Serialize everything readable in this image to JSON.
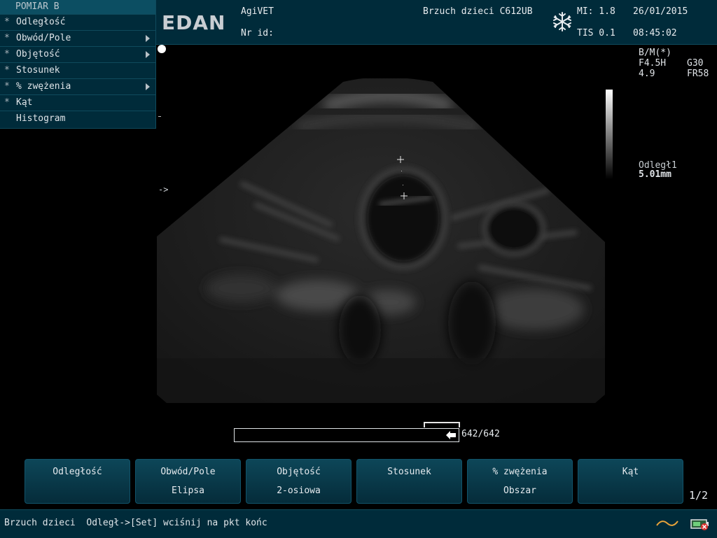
{
  "header": {
    "brand": "EDAN",
    "app": "AgiVET",
    "patient_id_label": "Nr id:",
    "exam": "Brzuch dzieci C612UB",
    "mi": "MI: 1.8",
    "tis": "TIS 0.1",
    "date": "26/01/2015",
    "time": "08:45:02",
    "freeze_icon": "snowflake-icon"
  },
  "menu": {
    "title": "POMIAR B",
    "items": [
      {
        "label": "Odległość",
        "star": "*",
        "arrow": false
      },
      {
        "label": "Obwód/Pole",
        "star": "*",
        "arrow": true
      },
      {
        "label": "Objętość",
        "star": "*",
        "arrow": true
      },
      {
        "label": "Stosunek",
        "star": "*",
        "arrow": false
      },
      {
        "label": "% zwężenia",
        "star": "*",
        "arrow": true
      },
      {
        "label": "Kąt",
        "star": "*",
        "arrow": false
      },
      {
        "label": "Histogram",
        "star": "",
        "arrow": false
      }
    ]
  },
  "params": {
    "mode": "B/M(*)",
    "freq": "F4.5H",
    "gain": "G30",
    "depth": "4.9",
    "frame_rate": "FR58"
  },
  "measurement": {
    "name": "Odległ1",
    "value": "5.01mm"
  },
  "depth_marker": "->",
  "cine": {
    "counter": "642/642",
    "progress": 1.0
  },
  "softkeys": [
    {
      "line1": "Odległość",
      "line2": ""
    },
    {
      "line1": "Obwód/Pole",
      "line2": "Elipsa"
    },
    {
      "line1": "Objętość",
      "line2": "2-osiowa"
    },
    {
      "line1": "Stosunek",
      "line2": ""
    },
    {
      "line1": "% zwężenia",
      "line2": "Obszar"
    },
    {
      "line1": "Kąt",
      "line2": ""
    }
  ],
  "page_indicator": "1/2",
  "status": {
    "text": "Brzuch dzieci  Odległ->[Set] wciśnij na pkt końc",
    "icons": [
      "trackball-icon",
      "battery-icon"
    ]
  },
  "colors": {
    "panel": "#002b3a",
    "border": "#0f4a5c",
    "accent": "#e8a33a"
  }
}
